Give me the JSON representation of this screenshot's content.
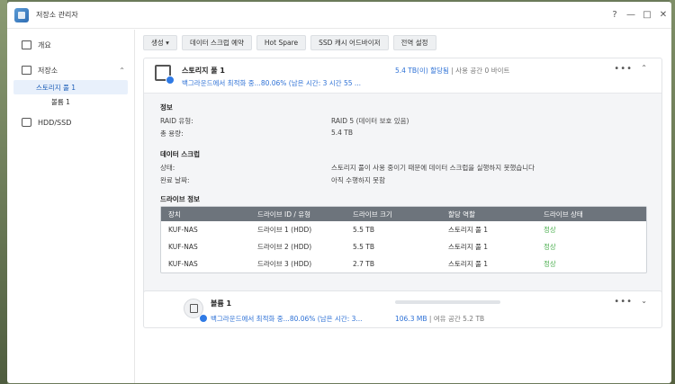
{
  "window": {
    "title": "저장소 관리자",
    "controls": [
      "?",
      "—",
      "□",
      "✕"
    ]
  },
  "sidebar": {
    "items": [
      {
        "label": "개요",
        "icon": "overview-icon"
      },
      {
        "label": "저장소",
        "icon": "storage-icon",
        "expanded": true
      },
      {
        "label": "HDD/SSD",
        "icon": "disk-icon"
      }
    ],
    "subitems": [
      {
        "label": "스토리지 풀 1",
        "active": true
      },
      {
        "label": "볼륨 1"
      }
    ]
  },
  "toolbar": {
    "create": "생성 ▾",
    "data_scrub_schedule": "데이터 스크럽 예약",
    "hot_spare": "Hot Spare",
    "ssd_cache_advisor": "SSD 캐시 어드바이저",
    "global_settings": "전역 설정"
  },
  "pool": {
    "name": "스토리지 풀 1",
    "status": "백그라운드에서 최적화 중...80.06% (남은 시간: 3 시간 55 ...",
    "capacity_allocated": "5.4 TB(이) 할당됨",
    "capacity_separator": " | ",
    "capacity_free": "사용 공간 0 바이트",
    "more": "•••",
    "collapse": "⌃",
    "info": {
      "title": "정보",
      "raid_type_label": "RAID 유형:",
      "raid_type_value": "RAID 5 (데이터 보호 있음)",
      "total_capacity_label": "총 용량:",
      "total_capacity_value": "5.4 TB"
    },
    "scrub": {
      "title": "데이터 스크럽",
      "status_label": "상태:",
      "status_value": "스토리지 풀이 사용 중이기 때문에 데이터 스크럽을 실행하지 못했습니다",
      "completed_label": "완료 날짜:",
      "completed_value": "아직 수행하지 못함"
    },
    "drives": {
      "title": "드라이브 정보",
      "columns": [
        "장치",
        "드라이브 ID / 유형",
        "드라이브 크기",
        "할당 역할",
        "드라이브 상태"
      ],
      "rows": [
        [
          "KUF-NAS",
          "드라이브 1 (HDD)",
          "5.5 TB",
          "스토리지 풀 1",
          "정상"
        ],
        [
          "KUF-NAS",
          "드라이브 2 (HDD)",
          "5.5 TB",
          "스토리지 풀 1",
          "정상"
        ],
        [
          "KUF-NAS",
          "드라이브 3 (HDD)",
          "2.7 TB",
          "스토리지 풀 1",
          "정상"
        ]
      ]
    }
  },
  "volume": {
    "name": "볼륨 1",
    "status": "백그라운드에서 최적화 중...80.06% (남은 시간: 3...",
    "used": "106.3 MB",
    "separator": " | ",
    "free": "여유 공간 5.2 TB",
    "usage_fraction": 0.0,
    "more": "•••",
    "expand": "⌄"
  },
  "colors": {
    "accent": "#2f72d6",
    "ok": "#4caf50",
    "table_header": "#6d747c"
  }
}
